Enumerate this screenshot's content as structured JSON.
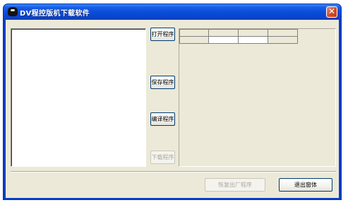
{
  "window": {
    "title": "DV程控版机下载软件",
    "close_glyph": "✕"
  },
  "side_buttons": [
    {
      "label": "打开程序",
      "enabled": true
    },
    {
      "label": "保存程序",
      "enabled": true
    },
    {
      "label": "编译程序",
      "enabled": true
    },
    {
      "label": "下载程序",
      "enabled": false
    }
  ],
  "bottom_buttons": {
    "restore_label": "恢复出厂程序",
    "restore_enabled": false,
    "exit_label": "退出窗体",
    "exit_enabled": true
  },
  "grid": {
    "columns": 4,
    "rows": 2
  },
  "colors": {
    "title_bar": "#0a4ed8",
    "dialog_face": "#ece9d8",
    "close_button": "#d4502e"
  }
}
